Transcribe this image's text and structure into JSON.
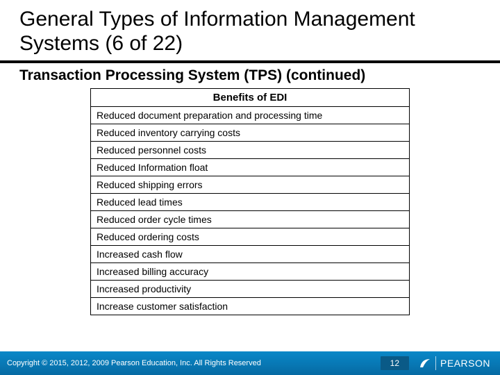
{
  "title": "General Types of Information Management Systems (6 of 22)",
  "subtitle": "Transaction Processing System (TPS) (continued)",
  "table": {
    "header": "Benefits of EDI",
    "rows": [
      "Reduced document preparation and processing time",
      "Reduced inventory carrying costs",
      "Reduced personnel costs",
      "Reduced Information float",
      "Reduced shipping errors",
      "Reduced lead times",
      "Reduced order cycle times",
      "Reduced ordering costs",
      "Increased cash flow",
      "Increased billing accuracy",
      "Increased productivity",
      "Increase customer satisfaction"
    ]
  },
  "footer": {
    "copyright": "Copyright © 2015, 2012, 2009 Pearson Education, Inc. All Rights Reserved",
    "page": "12",
    "brand": "PEARSON"
  }
}
